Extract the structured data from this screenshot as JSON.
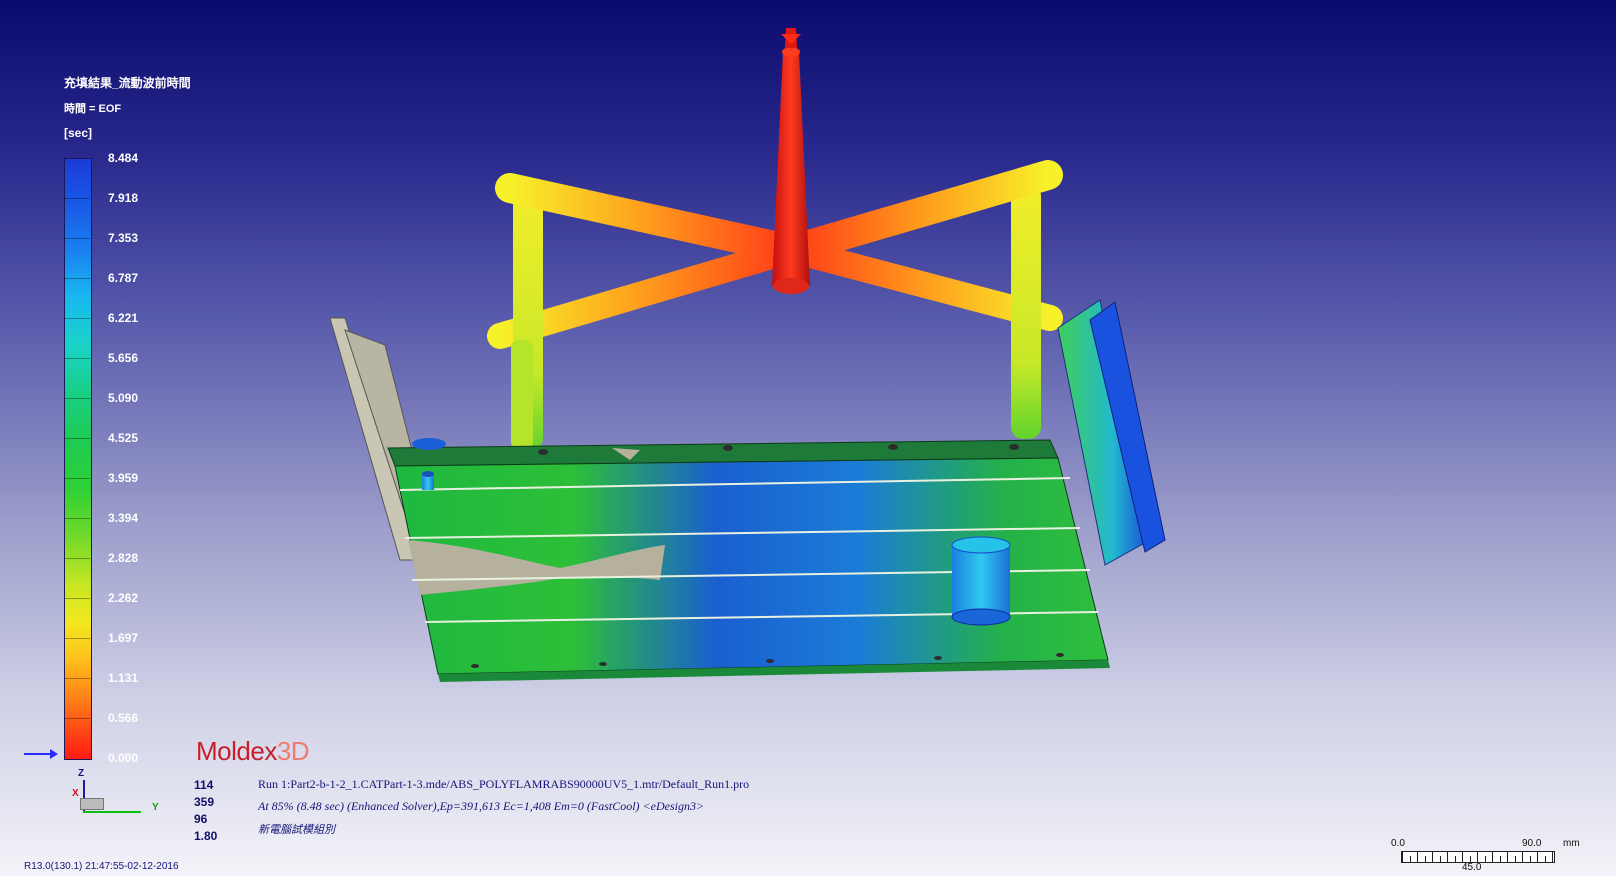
{
  "legend": {
    "title": "充填結果_流動波前時間",
    "subtitle": "時間 = EOF",
    "unit": "[sec]",
    "ticks": [
      "8.484",
      "7.918",
      "7.353",
      "6.787",
      "6.221",
      "5.656",
      "5.090",
      "4.525",
      "3.959",
      "3.394",
      "2.828",
      "2.262",
      "1.697",
      "1.131",
      "0.566",
      "0.000"
    ],
    "colors": {
      "max": "#1a3bd8",
      "mid": "#2ed135",
      "low": "#f2e91f",
      "min": "#ff1a13"
    }
  },
  "logo": {
    "name": "Moldex",
    "suffix": "3D"
  },
  "stats": [
    "114",
    "359",
    "96",
    "1.80"
  ],
  "info": {
    "line1": "Run 1:Part2-b-1-2_1.CATPart-1-3.mde/ABS_POLYFLAMRABS90000UV5_1.mtr/Default_Run1.pro",
    "line2": "At 85% (8.48 sec) (Enhanced Solver),Ep=391,613 Ec=1,408 Em=0 (FastCool) <eDesign3>",
    "line3": "新電腦試模組別"
  },
  "axes": {
    "z": "Z",
    "x": "X",
    "y": "Y"
  },
  "version": "R13.0(130.1) 21:47:55-02-12-2016",
  "scale": {
    "start": "0.0",
    "end": "90.0",
    "mid": "45.0",
    "unit": "mm"
  }
}
